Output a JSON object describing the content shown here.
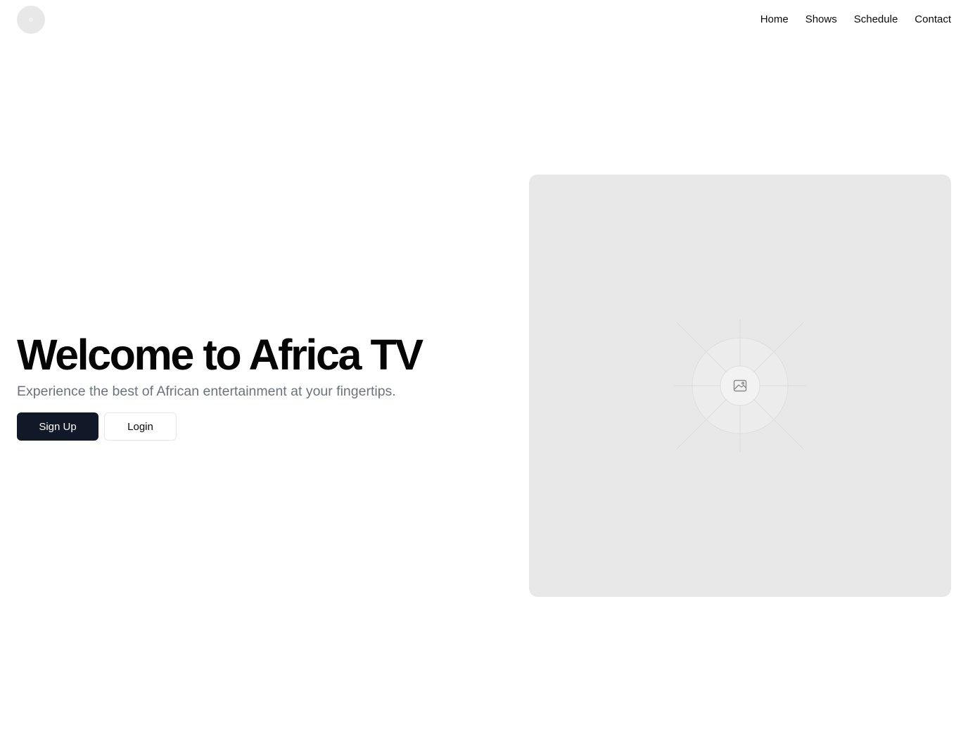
{
  "header": {
    "logo_icon": "circle-logo",
    "nav": [
      "Home",
      "Shows",
      "Schedule",
      "Contact"
    ]
  },
  "hero": {
    "title": "Welcome to Africa TV",
    "subtitle": "Experience the best of African entertainment at your fingertips.",
    "signup_label": "Sign Up",
    "login_label": "Login"
  },
  "media": {
    "placeholder_icon": "image-icon",
    "background_color": "#e8e8e8"
  },
  "colors": {
    "primary": "#111827",
    "muted_text": "#6b7280"
  }
}
